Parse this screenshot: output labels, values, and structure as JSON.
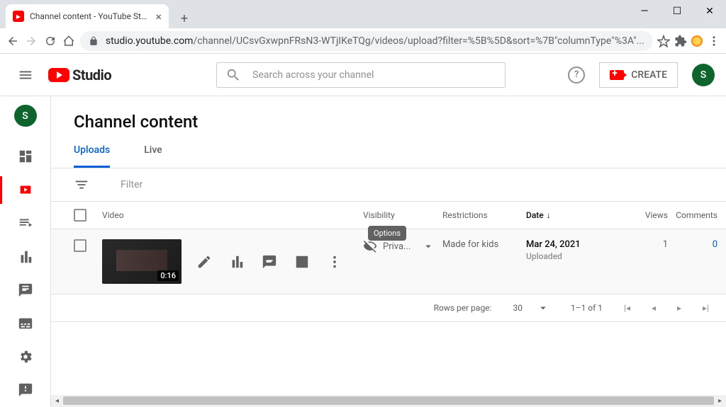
{
  "browser": {
    "tab_title": "Channel content - YouTube Studi",
    "url_domain": "studio.youtube.com",
    "url_path": "/channel/UCsvGxwpnFRsN3-WTjIKeTQg/videos/upload?filter=%5B%5D&sort=%7B\"columnType\"%3A\"..."
  },
  "header": {
    "logo_text": "Studio",
    "search_placeholder": "Search across your channel",
    "create_label": "CREATE",
    "avatar_initial": "S"
  },
  "sidebar": {
    "avatar_initial": "S"
  },
  "page": {
    "title": "Channel content",
    "tabs": [
      "Uploads",
      "Live"
    ],
    "filter_label": "Filter",
    "columns": {
      "video": "Video",
      "visibility": "Visibility",
      "restrictions": "Restrictions",
      "date": "Date",
      "views": "Views",
      "comments": "Comments"
    },
    "tooltip": "Options",
    "rows": [
      {
        "duration": "0:16",
        "visibility": "Priva...",
        "restrictions": "Made for kids",
        "date": "Mar 24, 2021",
        "date_status": "Uploaded",
        "views": "1",
        "comments": "0"
      }
    ],
    "pagination": {
      "rows_label": "Rows per page:",
      "rows_value": "30",
      "range": "1–1 of 1"
    }
  }
}
